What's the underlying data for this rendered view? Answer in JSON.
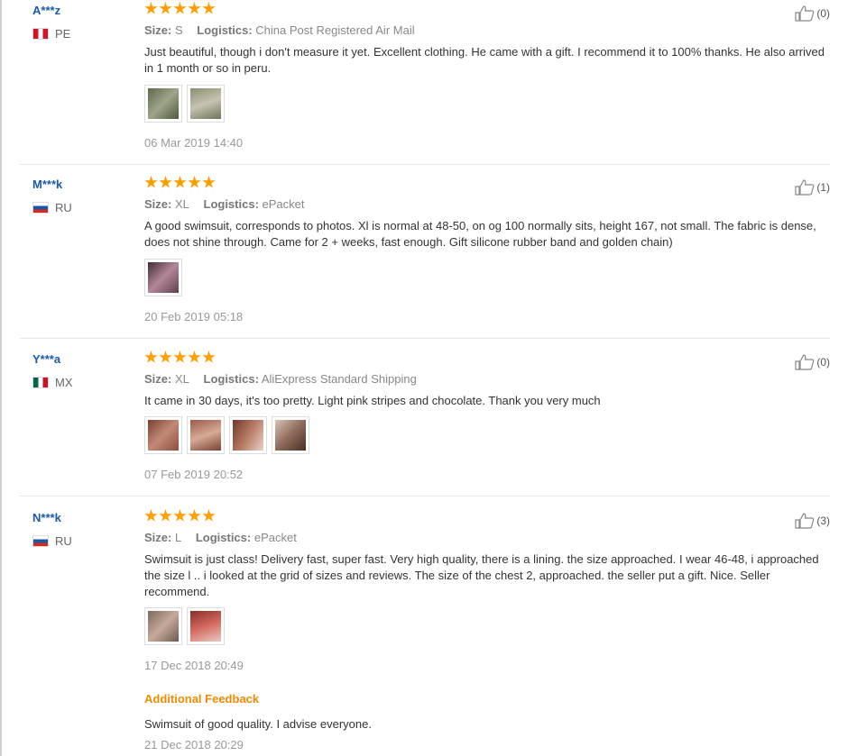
{
  "reviews": [
    {
      "user": "A***z",
      "country": "PE",
      "size_label": "Size:",
      "size": "S",
      "logistics_label": "Logistics:",
      "logistics": "China Post Registered Air Mail",
      "text": "Just beautiful, though i don't measure it yet. Excellent clothing. He came with a gift. I recommend it to 100% thanks. He also arrived in 1 month or so in peru.",
      "date": "06 Mar 2019 14:40",
      "helpful": "(0)",
      "rating": 5,
      "photos": [
        "#6e7a56",
        "#8a8f6e"
      ]
    },
    {
      "user": "M***k",
      "country": "RU",
      "size_label": "Size:",
      "size": "XL",
      "logistics_label": "Logistics:",
      "logistics": "ePacket",
      "text": "A good swimsuit, corresponds to photos. Xl is normal at 48-50, on og 100 normally sits, height 167, not small. The fabric is dense, does not shine through. Came for 2 + weeks, fast enough. Gift silicone rubber band and golden chain)",
      "date": "20 Feb 2019 05:18",
      "helpful": "(1)",
      "rating": 5,
      "photos": [
        "#7b5a6a"
      ]
    },
    {
      "user": "Y***a",
      "country": "MX",
      "size_label": "Size:",
      "size": "XL",
      "logistics_label": "Logistics:",
      "logistics": "AliExpress Standard Shipping",
      "text": "It came in 30 days, it's too pretty. Light pink stripes and chocolate. Thank you very much",
      "date": "07 Feb 2019 20:52",
      "helpful": "(0)",
      "rating": 5,
      "photos": [
        "#9a5a48",
        "#a86a52",
        "#8e5444",
        "#b08a78"
      ]
    },
    {
      "user": "N***k",
      "country": "RU",
      "size_label": "Size:",
      "size": "L",
      "logistics_label": "Logistics:",
      "logistics": "ePacket",
      "text": "Swimsuit is just class! Delivery fast, super fast. Very high quality, there is a lining. the size approached. I wear 46-48, i approached the size l .. i looked at the grid of sizes and reviews. The size of the chest 2, approached. the seller put a gift. Nice. Seller recommend.",
      "date": "17 Dec 2018 20:49",
      "helpful": "(3)",
      "rating": 5,
      "photos": [
        "#a88a7a",
        "#b0504a"
      ],
      "additional_title": "Additional Feedback",
      "additional_text": "Swimsuit of good quality. I advise everyone.",
      "additional_date": "21 Dec 2018 20:29"
    }
  ],
  "colors": {
    "user_link": "#1a5aa8",
    "star": "#ff9c00",
    "additional_title": "#f08a00"
  },
  "icons": {
    "helpful": "thumbs-up-icon"
  }
}
